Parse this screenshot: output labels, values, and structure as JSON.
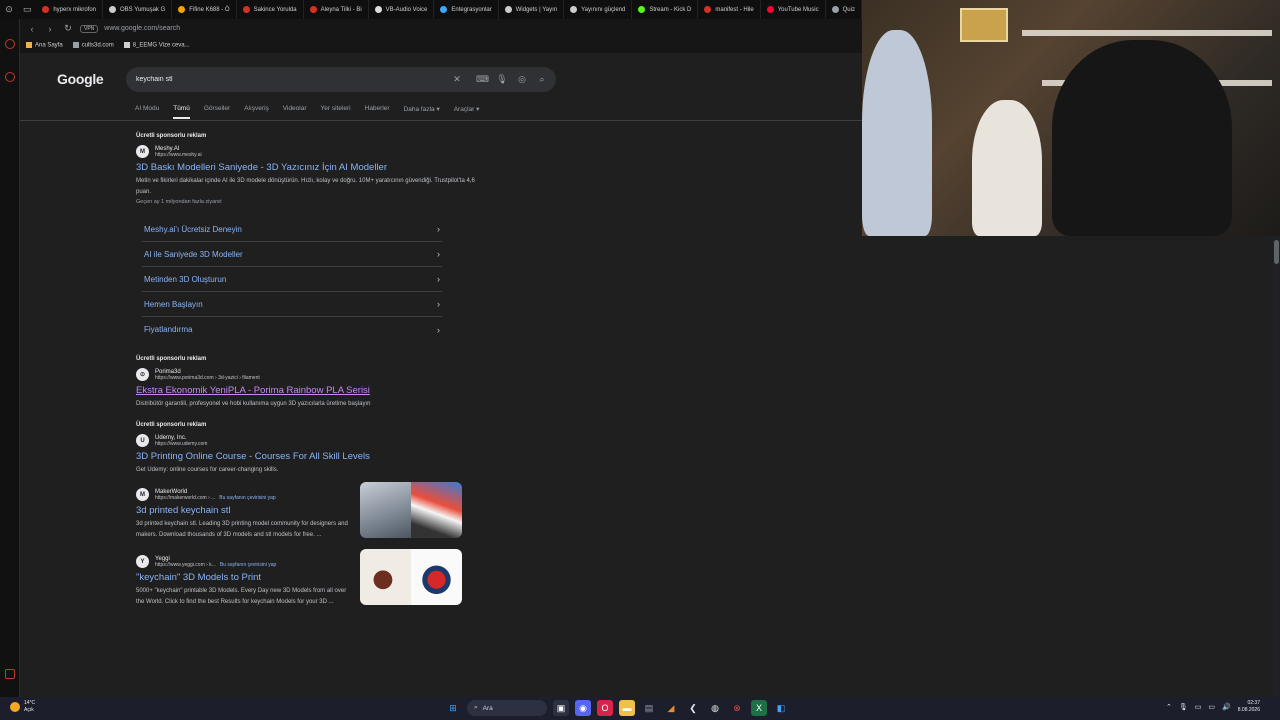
{
  "browser": {
    "tabs": [
      {
        "label": "hyperx mikrofon",
        "color": "#d93025"
      },
      {
        "label": "OBS Yumuşak G",
        "color": "#cccccc"
      },
      {
        "label": "Fifine K688 - Ö",
        "color": "#f0a500"
      },
      {
        "label": "Sakince Yorulda",
        "color": "#d93025"
      },
      {
        "label": "Aleyna Tilki - Bi",
        "color": "#d93025"
      },
      {
        "label": "VB-Audio Voice",
        "color": "#dddddd"
      },
      {
        "label": "Entegrasyonlar",
        "color": "#3ea6ff"
      },
      {
        "label": "Widgets | Yayın",
        "color": "#cccccc"
      },
      {
        "label": "Yayınını güçlend",
        "color": "#cccccc"
      },
      {
        "label": "Stream - Kick D",
        "color": "#53fc18"
      },
      {
        "label": "manifest - Hile",
        "color": "#d93025"
      },
      {
        "label": "YouTube Music",
        "color": "#ff0033"
      },
      {
        "label": "Quiz",
        "color": "#9aa0a6"
      }
    ],
    "vpn_label": "VPN",
    "url": "www.google.com/search",
    "bookmarks": [
      "Ana Sayfa",
      "cults3d.com",
      "8_EEMG Vize ceva..."
    ]
  },
  "google": {
    "logo": "Google",
    "query": "keychain stl",
    "tabs": [
      "AI Modu",
      "Tümü",
      "Görseller",
      "Alışveriş",
      "Videolar",
      "Yer siteleri",
      "Haberler",
      "Daha fazla",
      "Araçlar"
    ],
    "active_tab": "Tümü"
  },
  "results": {
    "ad1": {
      "sponsored": "Ücretli sponsorlu reklam",
      "site": "Meshy.AI",
      "url": "https://www.meshy.ai",
      "title": "3D Baskı Modelleri Saniyede - 3D Yazıcınız İçin AI Modeller",
      "desc": "Metin ve fikirleri dakikalar içinde AI ile 3D modele dönüştürün. Hızlı, kolay ve doğru. 10M+ yaratıcının güvendiği. Trustpilot'ta 4,6 puan.",
      "note": "Geçen ay 1 milyondan fazla ziyaret",
      "sitelinks": [
        "Meshy.ai'ı Ücretsiz Deneyin",
        "AI ile Saniyede 3D Modeller",
        "Metinden 3D Oluşturun",
        "Hemen Başlayın",
        "Fiyatlandırma"
      ]
    },
    "ad2": {
      "sponsored": "Ücretli sponsorlu reklam",
      "site": "Porima3d",
      "url": "https://www.porima3d.com › 3d-yazici › filament",
      "title": "Ekstra Ekonomik YeniPLA - Porima Rainbow PLA Serisi",
      "desc": "Distribütör garantili, profesyonel ve hobi kullanıma uygun 3D yazıcılarla üretime başlayın"
    },
    "ad3": {
      "sponsored": "Ücretli sponsorlu reklam",
      "site": "Udemy, Inc.",
      "url": "https://www.udemy.com",
      "title": "3D Printing Online Course - Courses For All Skill Levels",
      "desc": "Get Udemy: online courses for career-changing skills."
    },
    "org1": {
      "site": "MakerWorld",
      "url": "https://makerworld.com › ...",
      "translate": "Bu sayfanın çevirisini yap",
      "title": "3d printed keychain stl",
      "desc": "3d printed keychain stl. Leading 3D printing model community for designers and makers. Download thousands of 3D models and stl models for free. ..."
    },
    "org2": {
      "site": "Yeggi",
      "url": "https://www.yeggi.com › k...",
      "translate": "Bu sayfanın çevirisini yap",
      "title": "\"keychain\" 3D Models to Print",
      "desc": "5000+ \"keychain\" printable 3D Models. Every Day new 3D Models from all over the World. Click to find the best Results for keychain Models for your 3D ..."
    }
  },
  "taskbar": {
    "weather_temp": "14°C",
    "weather_desc": "Açık",
    "search_label": "Ara",
    "time": "02:37",
    "date": "8.08.2026"
  }
}
